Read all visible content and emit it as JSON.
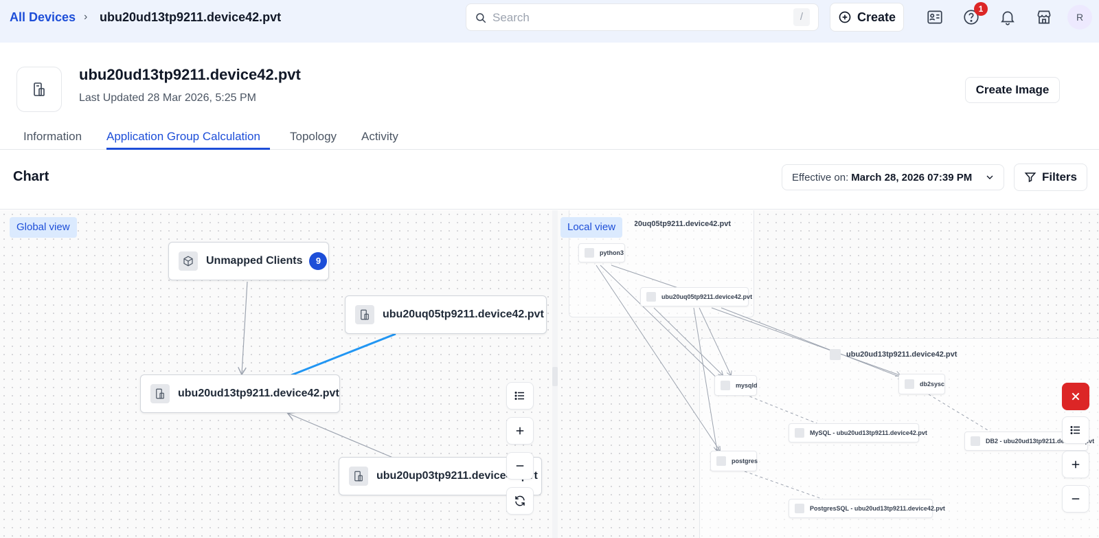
{
  "breadcrumb": {
    "root": "All Devices",
    "separator": "›",
    "current": "ubu20ud13tp9211.device42.pvt"
  },
  "search": {
    "placeholder": "Search",
    "shortcut": "/"
  },
  "toolbar": {
    "create_label": "Create",
    "help_badge": "1",
    "avatar_initial": "R"
  },
  "device": {
    "title": "ubu20ud13tp9211.device42.pvt",
    "last_updated": "Last Updated 28 Mar 2026, 5:25 PM",
    "create_image_label": "Create Image"
  },
  "tabs": [
    {
      "label": "Information",
      "active": false
    },
    {
      "label": "Application Group Calculation",
      "active": true
    },
    {
      "label": "Topology",
      "active": false
    },
    {
      "label": "Activity",
      "active": false
    }
  ],
  "chart": {
    "title": "Chart",
    "effective_label": "Effective on:",
    "effective_value": "March 28, 2026 07:39 PM",
    "filters_label": "Filters"
  },
  "global_view": {
    "label": "Global view",
    "nodes": [
      {
        "label": "Unmapped Clients",
        "count": "9"
      },
      {
        "label": "ubu20uq05tp9211.device42.pvt"
      },
      {
        "label": "ubu20ud13tp9211.device42.pvt"
      },
      {
        "label": "ubu20up03tp9211.device42.pvt"
      }
    ]
  },
  "local_view": {
    "label": "Local view",
    "group1_label": "ubu20uq05tp9211.device42.pvt",
    "group2_label": "ubu20ud13tp9211.device42.pvt",
    "nodes": {
      "python3": "python3",
      "host1": "ubu20uq05tp9211.device42.pvt",
      "mysqld": "mysqld",
      "db2sysc": "db2sysc",
      "postgres": "postgres",
      "mysql_app": "MySQL - ubu20ud13tp9211.device42.pvt",
      "db2_app": "DB2 - ubu20ud13tp9211.device42.pvt",
      "pg_app": "PostgresSQL - ubu20ud13tp9211.device42.pvt"
    }
  },
  "colors": {
    "accent": "#1d4ed8",
    "edge_highlight": "#2196f3",
    "danger": "#dc2626"
  }
}
